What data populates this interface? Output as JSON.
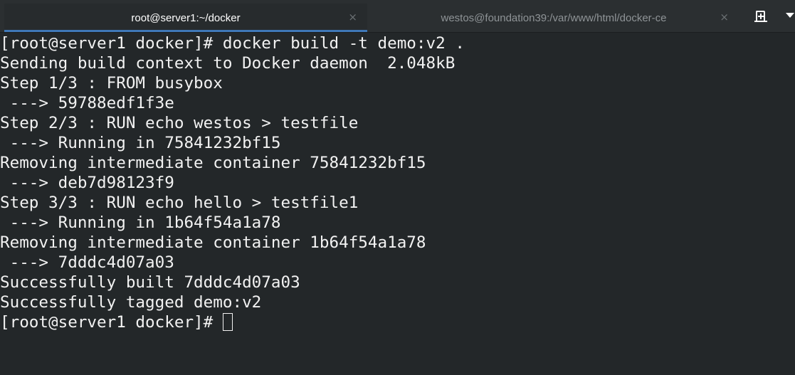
{
  "tabs": [
    {
      "label": "root@server1:~/docker",
      "active": true,
      "close_icon": "close-icon"
    },
    {
      "label": "westos@foundation39:/var/www/html/docker-ce",
      "active": false,
      "close_icon": "close-icon"
    }
  ],
  "tab_controls": {
    "new_tab_icon": "new-tab-icon",
    "menu_icon": "chevron-down-icon"
  },
  "close_glyph": "×",
  "colors": {
    "accent": "#3f78b8",
    "background": "#232729",
    "text": "#f2f2f2"
  },
  "terminal": {
    "lines": [
      "[root@server1 docker]# docker build -t demo:v2 .",
      "Sending build context to Docker daemon  2.048kB",
      "Step 1/3 : FROM busybox",
      " ---> 59788edf1f3e",
      "Step 2/3 : RUN echo westos > testfile",
      " ---> Running in 75841232bf15",
      "Removing intermediate container 75841232bf15",
      " ---> deb7d98123f9",
      "Step 3/3 : RUN echo hello > testfile1",
      " ---> Running in 1b64f54a1a78",
      "Removing intermediate container 1b64f54a1a78",
      " ---> 7dddc4d07a03",
      "Successfully built 7dddc4d07a03",
      "Successfully tagged demo:v2"
    ],
    "prompt": "[root@server1 docker]# "
  }
}
